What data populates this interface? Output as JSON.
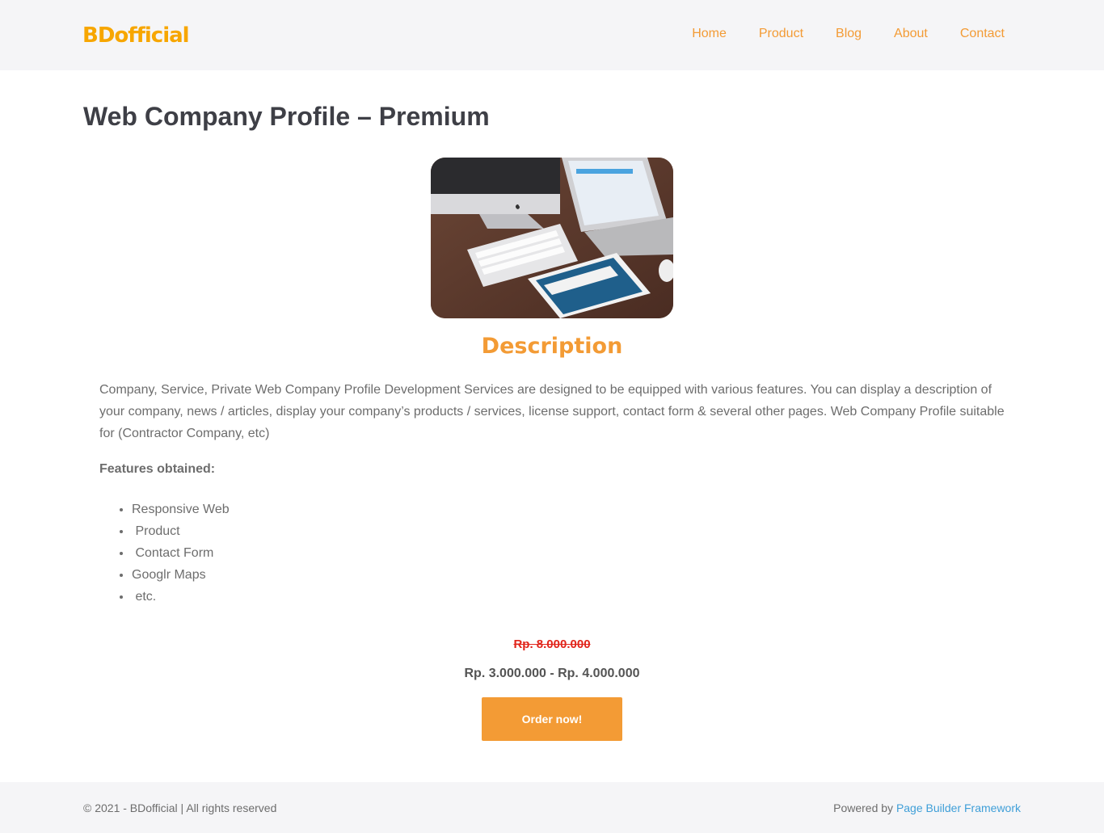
{
  "header": {
    "logo": "BDofficial",
    "nav": [
      "Home",
      "Product",
      "Blog",
      "About",
      "Contact"
    ]
  },
  "main": {
    "title": "Web Company Profile – Premium",
    "description_heading": "Description",
    "description": "Company, Service, Private Web Company Profile Development Services are designed to be equipped with various features. You can display a description of your company, news / articles, display your company’s products / services, license support, contact form & several other pages. Web Company Profile suitable for (Contractor Company, etc)",
    "features_label": "Features obtained:",
    "features": [
      "Responsive Web",
      " Product",
      " Contact Form",
      "Googlr Maps",
      " etc."
    ],
    "old_price": "Rp. 8.000.000",
    "price": "Rp. 3.000.000 - Rp. 4.000.000",
    "order_label": "Order now!"
  },
  "footer": {
    "copyright": "© 2021 - BDofficial | All rights reserved",
    "powered_prefix": "Powered by ",
    "powered_link": "Page Builder Framework"
  },
  "colors": {
    "accent": "#f39b35",
    "logo": "#f7a600",
    "strike_price": "#e1251b",
    "link": "#3f9fd8"
  }
}
